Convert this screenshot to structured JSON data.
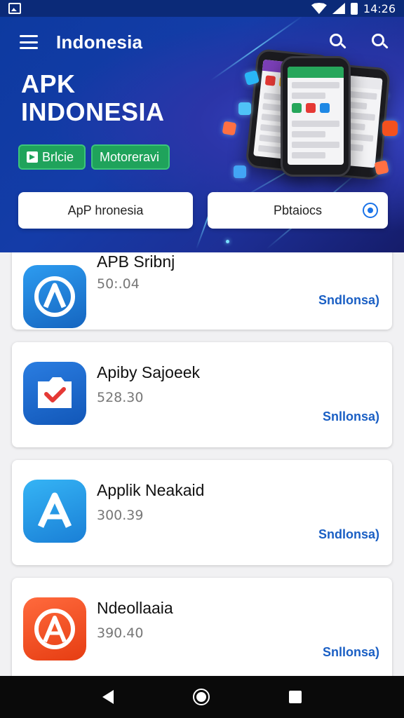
{
  "status_bar": {
    "time": "14:26"
  },
  "header": {
    "title": "Indonesia",
    "hero_line1": "APK",
    "hero_line2": "INDONESIA",
    "tags": [
      "Brlcie",
      "Motoreravi"
    ],
    "pills": [
      "ApP hronesia",
      "Pbtaiocs"
    ]
  },
  "apps": [
    {
      "name": "APB Sribnj",
      "price": "50:.04",
      "link": "Sndlonsa)",
      "icon": "a-arrow-icon",
      "color": "#1e88e5"
    },
    {
      "name": "Apiby Sajoeek",
      "price": "528.30",
      "link": "Snllonsa)",
      "icon": "check-folder-icon",
      "color": "#1565c0"
    },
    {
      "name": "Applik Neakaid",
      "price": "300.39",
      "link": "Sndlonsa)",
      "icon": "a-letter-icon",
      "color": "#1e9be8"
    },
    {
      "name": "Ndeollaaia",
      "price": "390.40",
      "link": "Snllonsa)",
      "icon": "a-circle-icon",
      "color": "#f24a1d"
    }
  ],
  "colors": {
    "header": "#0d3aa0",
    "tag": "#1fa35b",
    "link": "#1a5fc4"
  }
}
